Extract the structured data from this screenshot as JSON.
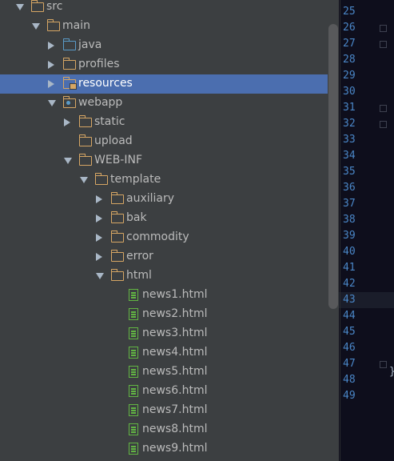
{
  "tree": {
    "items": [
      {
        "label": "src",
        "arrow": "down",
        "icon": "folder-icon",
        "depth": 0,
        "selected": false
      },
      {
        "label": "main",
        "arrow": "down",
        "icon": "folder-icon",
        "depth": 1,
        "selected": false
      },
      {
        "label": "java",
        "arrow": "right",
        "icon": "source-folder-icon",
        "depth": 2,
        "selected": false
      },
      {
        "label": "profiles",
        "arrow": "right",
        "icon": "folder-icon",
        "depth": 2,
        "selected": false
      },
      {
        "label": "resources",
        "arrow": "right",
        "icon": "resources-folder-icon",
        "depth": 2,
        "selected": true
      },
      {
        "label": "webapp",
        "arrow": "down",
        "icon": "web-folder-icon",
        "depth": 2,
        "selected": false
      },
      {
        "label": "static",
        "arrow": "right",
        "icon": "folder-icon",
        "depth": 3,
        "selected": false
      },
      {
        "label": "upload",
        "arrow": "none",
        "icon": "folder-icon",
        "depth": 3,
        "selected": false
      },
      {
        "label": "WEB-INF",
        "arrow": "down",
        "icon": "folder-icon",
        "depth": 3,
        "selected": false
      },
      {
        "label": "template",
        "arrow": "down",
        "icon": "folder-icon",
        "depth": 4,
        "selected": false
      },
      {
        "label": "auxiliary",
        "arrow": "right",
        "icon": "folder-icon",
        "depth": 5,
        "selected": false
      },
      {
        "label": "bak",
        "arrow": "right",
        "icon": "folder-icon",
        "depth": 5,
        "selected": false
      },
      {
        "label": "commodity",
        "arrow": "right",
        "icon": "folder-icon",
        "depth": 5,
        "selected": false
      },
      {
        "label": "error",
        "arrow": "right",
        "icon": "folder-icon",
        "depth": 5,
        "selected": false
      },
      {
        "label": "html",
        "arrow": "down",
        "icon": "folder-icon",
        "depth": 5,
        "selected": false
      },
      {
        "label": "news1.html",
        "arrow": "none",
        "icon": "html-file-icon",
        "depth": 6,
        "selected": false
      },
      {
        "label": "news2.html",
        "arrow": "none",
        "icon": "html-file-icon",
        "depth": 6,
        "selected": false
      },
      {
        "label": "news3.html",
        "arrow": "none",
        "icon": "html-file-icon",
        "depth": 6,
        "selected": false
      },
      {
        "label": "news4.html",
        "arrow": "none",
        "icon": "html-file-icon",
        "depth": 6,
        "selected": false
      },
      {
        "label": "news5.html",
        "arrow": "none",
        "icon": "html-file-icon",
        "depth": 6,
        "selected": false
      },
      {
        "label": "news6.html",
        "arrow": "none",
        "icon": "html-file-icon",
        "depth": 6,
        "selected": false
      },
      {
        "label": "news7.html",
        "arrow": "none",
        "icon": "html-file-icon",
        "depth": 6,
        "selected": false
      },
      {
        "label": "news8.html",
        "arrow": "none",
        "icon": "html-file-icon",
        "depth": 6,
        "selected": false
      },
      {
        "label": "news9.html",
        "arrow": "none",
        "icon": "html-file-icon",
        "depth": 6,
        "selected": false
      }
    ]
  },
  "editor": {
    "line_numbers": [
      "25",
      "26",
      "27",
      "28",
      "29",
      "30",
      "31",
      "32",
      "33",
      "34",
      "35",
      "36",
      "37",
      "38",
      "39",
      "40",
      "41",
      "42",
      "43",
      "44",
      "45",
      "46",
      "47",
      "48",
      "49"
    ],
    "current_line": "43",
    "closing_brace": "}"
  },
  "colors": {
    "panel_bg": "#3c3f41",
    "selection": "#4b6eaf",
    "folder": "#d6a664",
    "source_folder": "#5a9bc8",
    "html_file": "#62b543",
    "line_number": "#4a86c7",
    "editor_bg": "#0e0e1c"
  }
}
